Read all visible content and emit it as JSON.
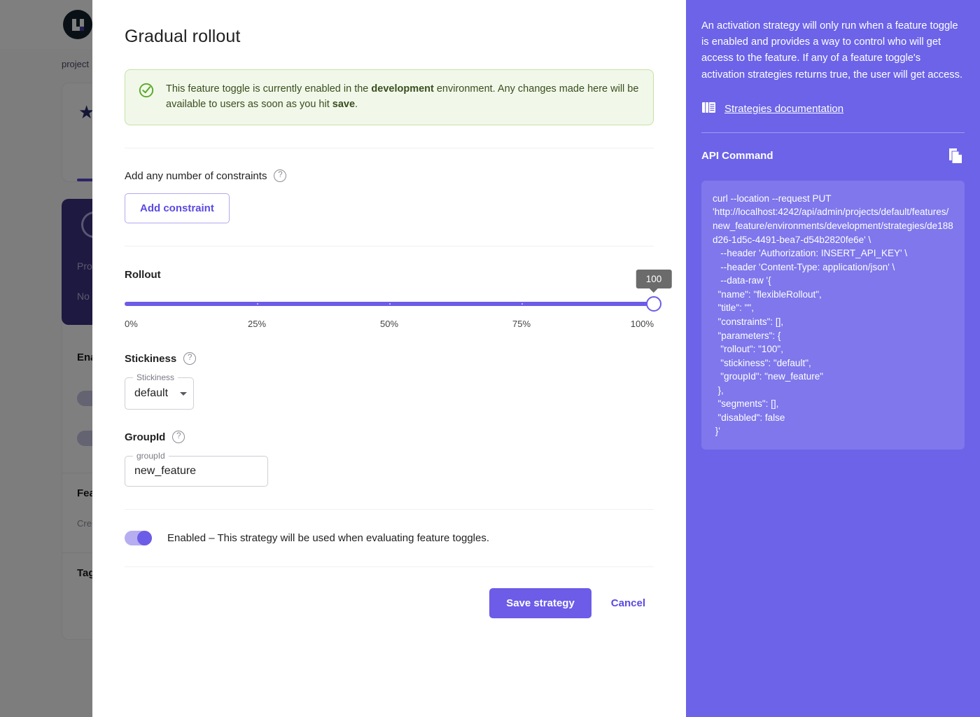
{
  "background": {
    "breadcrumb": "project",
    "logo_name": "unleash-logo",
    "purple_card": {
      "line1": "Pro",
      "line2": "No"
    },
    "sections": [
      {
        "title": "Ena",
        "sub": ""
      },
      {
        "title": "Fea",
        "sub": "Cre"
      },
      {
        "title": "Tag",
        "sub": ""
      }
    ]
  },
  "modal": {
    "title": "Gradual rollout",
    "alert": {
      "icon": "check-circle-icon",
      "text_part1": "This feature toggle is currently enabled in the ",
      "environment": "development",
      "text_part2": " environment. Any changes made here will be available to users as soon as you hit ",
      "save_word": "save",
      "text_part3": "."
    },
    "constraints": {
      "label": "Add any number of constraints",
      "help_icon": "help-icon",
      "add_button": "Add constraint"
    },
    "rollout": {
      "label": "Rollout",
      "value": "100",
      "percent": 100,
      "tick_labels": [
        "0%",
        "25%",
        "50%",
        "75%",
        "100%"
      ],
      "tick_positions": [
        0,
        25,
        50,
        75,
        100
      ]
    },
    "stickiness": {
      "title": "Stickiness",
      "legend": "Stickiness",
      "value": "default",
      "help_icon": "help-icon"
    },
    "groupid": {
      "title": "GroupId",
      "legend": "groupId",
      "value": "new_feature",
      "help_icon": "help-icon"
    },
    "enabled": {
      "state": "on",
      "text": "Enabled – This strategy will be used when evaluating feature toggles."
    },
    "footer": {
      "save_label": "Save strategy",
      "cancel_label": "Cancel"
    }
  },
  "side_panel": {
    "description": "An activation strategy will only run when a feature toggle is enabled and provides a way to control who will get access to the feature. If any of a feature toggle's activation strategies returns true, the user will get access.",
    "docs_icon": "book-icon",
    "docs_link": "Strategies documentation",
    "api_title": "API Command",
    "copy_icon": "copy-icon",
    "api_command": "curl --location --request PUT 'http://localhost:4242/api/admin/projects/default/features/new_feature/environments/development/strategies/de188d26-1d5c-4491-bea7-d54b2820fe6e' \\\n   --header 'Authorization: INSERT_API_KEY' \\\n   --header 'Content-Type: application/json' \\\n   --data-raw '{\n  \"name\": \"flexibleRollout\",\n  \"title\": \"\",\n  \"constraints\": [],\n  \"parameters\": {\n   \"rollout\": \"100\",\n   \"stickiness\": \"default\",\n   \"groupId\": \"new_feature\"\n  },\n  \"segments\": [],\n  \"disabled\": false\n }'"
  },
  "colors": {
    "accent": "#6c5ce7",
    "panel": "#6c63e8",
    "alert_bg": "#f1f8e9",
    "alert_border": "#c5e1a5",
    "alert_text": "#3a4d1f"
  }
}
